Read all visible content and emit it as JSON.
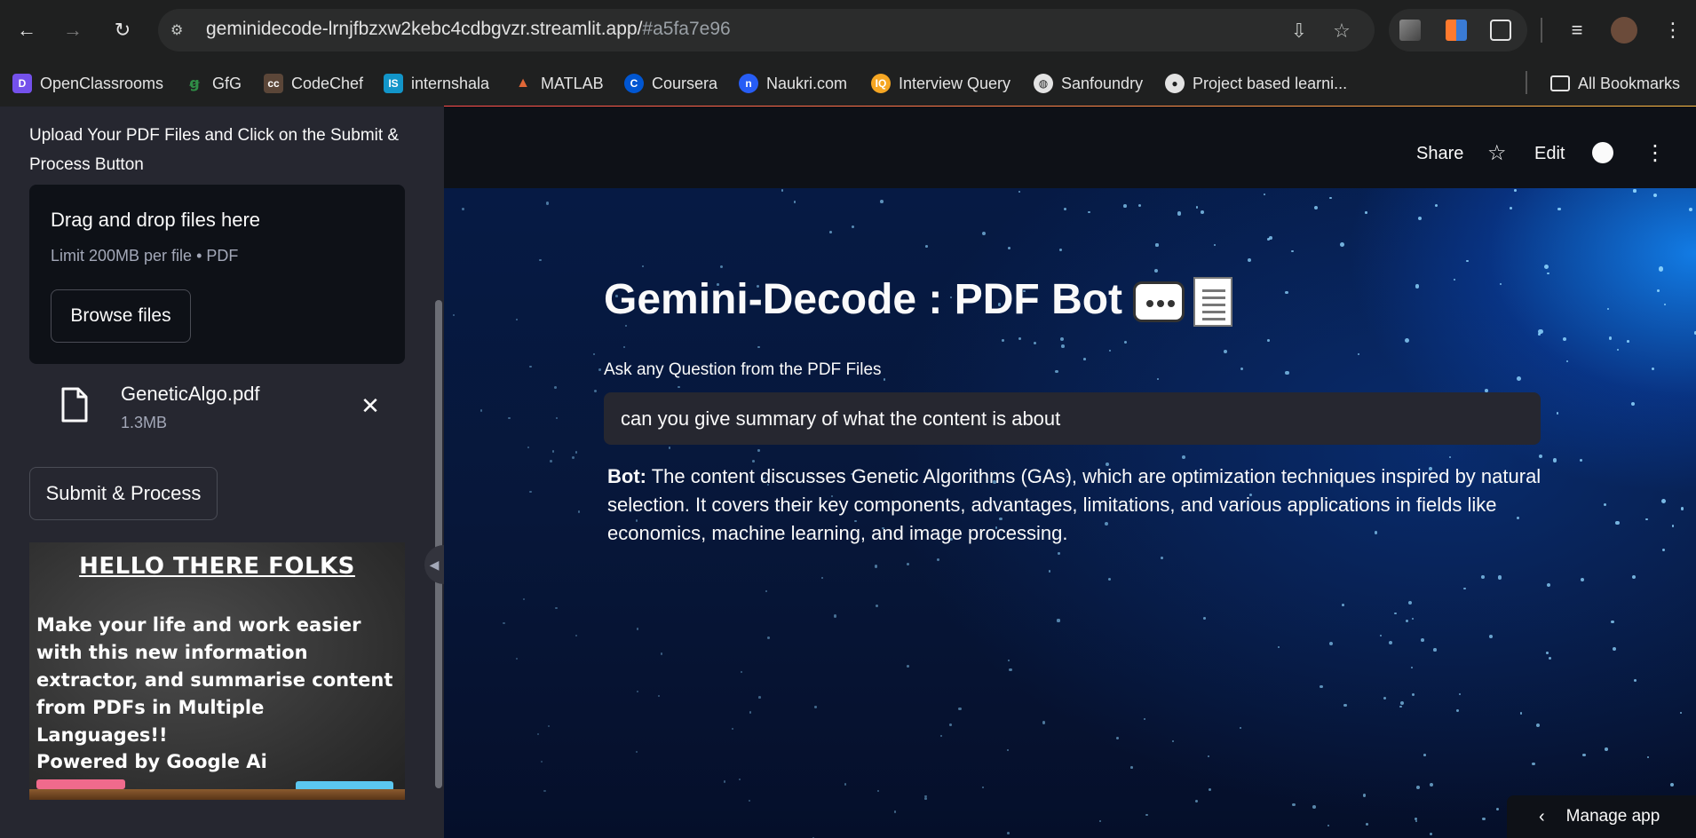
{
  "browser": {
    "url_main": "geminidecode-lrnjfbzxw2kebc4cdbgvzr.streamlit.app/",
    "url_hash": "#a5fa7e96",
    "bookmarks": [
      {
        "label": "OpenClassrooms",
        "icon": "openclassrooms-icon",
        "color": "#7451eb",
        "glyph": "D"
      },
      {
        "label": "GfG",
        "icon": "gfg-icon",
        "color": "#2f8d46",
        "glyph": "ꞡ"
      },
      {
        "label": "CodeChef",
        "icon": "codechef-icon",
        "color": "#5b4638",
        "glyph": "cc"
      },
      {
        "label": "internshala",
        "icon": "internshala-icon",
        "color": "#1295c9",
        "glyph": "IS"
      },
      {
        "label": "MATLAB",
        "icon": "matlab-icon",
        "color": "#e16737",
        "glyph": "▲"
      },
      {
        "label": "Coursera",
        "icon": "coursera-icon",
        "color": "#0056d2",
        "glyph": "C"
      },
      {
        "label": "Naukri.com",
        "icon": "naukri-icon",
        "color": "#275df5",
        "glyph": "n"
      },
      {
        "label": "Interview Query",
        "icon": "interview-query-icon",
        "color": "#f5a623",
        "glyph": "IQ"
      },
      {
        "label": "Sanfoundry",
        "icon": "globe-icon",
        "color": "#e3e3e3",
        "glyph": "◍"
      },
      {
        "label": "Project based learni...",
        "icon": "github-icon",
        "color": "#e3e3e3",
        "glyph": "●"
      }
    ],
    "all_bookmarks": "All Bookmarks"
  },
  "sidebar": {
    "upload_label": "Upload Your PDF Files and Click on the Submit & Process Button",
    "dropzone_title": "Drag and drop files here",
    "dropzone_limit": "Limit 200MB per file • PDF",
    "browse_label": "Browse files",
    "file_name": "GeneticAlgo.pdf",
    "file_size": "1.3MB",
    "submit_label": "Submit & Process",
    "banner": {
      "title": "HELLO THERE FOLKS",
      "text": "Make your life and work easier with this new information extractor, and summarise content from PDFs in Multiple Languages!!",
      "powered": "Powered by Google Ai"
    }
  },
  "header": {
    "share": "Share",
    "edit": "Edit"
  },
  "main": {
    "title": "Gemini-Decode : PDF Bot",
    "ask_label": "Ask any Question from the PDF Files",
    "question": "can you give summary of what the content is about",
    "bot_prefix": "Bot:",
    "bot_answer": "The content discusses Genetic Algorithms (GAs), which are optimization techniques inspired by natural selection. It covers their key components, advantages, limitations, and various applications in fields like economics, machine learning, and image processing."
  },
  "footer": {
    "manage_app": "Manage app"
  },
  "colors": {
    "accent_gradient_start": "#ff4b4b",
    "accent_gradient_end": "#ffbd45",
    "sidebar_bg": "#262730",
    "main_bg": "#0e1117"
  }
}
